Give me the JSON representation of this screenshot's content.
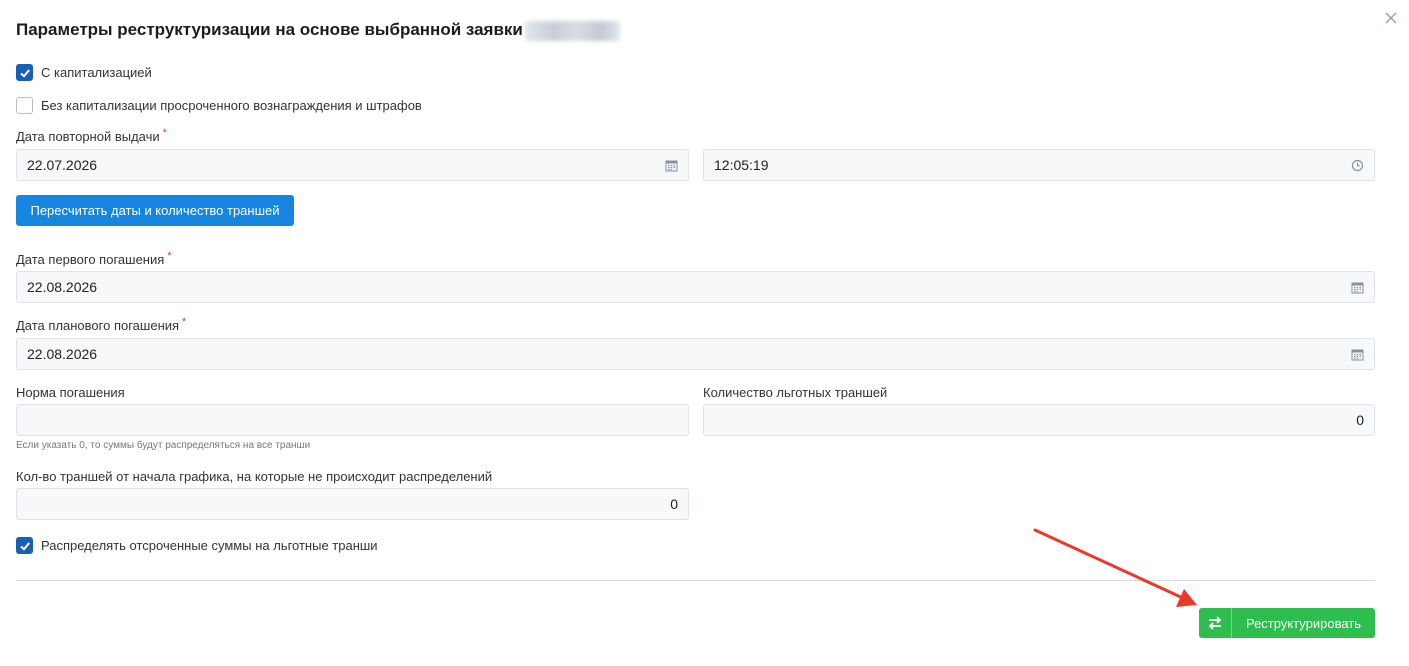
{
  "dialog": {
    "title": "Параметры реструктуризации на основе выбранной заявки",
    "close_icon": "close-icon"
  },
  "options": {
    "capitalization": {
      "label": "С капитализацией",
      "checked": true
    },
    "no_capitalization": {
      "label": "Без капитализации просроченного вознаграждения и штрафов",
      "checked": false
    }
  },
  "reissue": {
    "label": "Дата повторной выдачи",
    "required_mark": "*",
    "date_value": "22.07.2026",
    "time_value": "12:05:19",
    "date_icon": "calendar-icon",
    "time_icon": "clock-icon"
  },
  "recalc_button": {
    "label": "Пересчитать даты и количество траншей"
  },
  "first_payment": {
    "label": "Дата первого погашения",
    "required_mark": "*",
    "value": "22.08.2026"
  },
  "planned_payment": {
    "label": "Дата планового погашения",
    "required_mark": "*",
    "value": "22.08.2026"
  },
  "repayment_norm": {
    "label": "Норма погашения",
    "value": "",
    "hint": "Если указать 0, то суммы будут распределяться на все транши"
  },
  "grace_tranches": {
    "label": "Количество льготных траншей",
    "value": "0"
  },
  "skip_tranches": {
    "label": "Кол-во траншей от начала графика, на которые не происходит распределений",
    "value": "0"
  },
  "distribute_deferred": {
    "label": "Распределять отсроченные суммы на льготные транши",
    "checked": true
  },
  "restructure_button": {
    "label": "Реструктурировать",
    "icon": "swap-arrows-icon"
  },
  "colors": {
    "primary_blue": "#1585e0",
    "checkbox_blue": "#1a5fb4",
    "success_green": "#2ebd4f",
    "required_red": "#e53935",
    "annotation_arrow": "#e8392c"
  }
}
